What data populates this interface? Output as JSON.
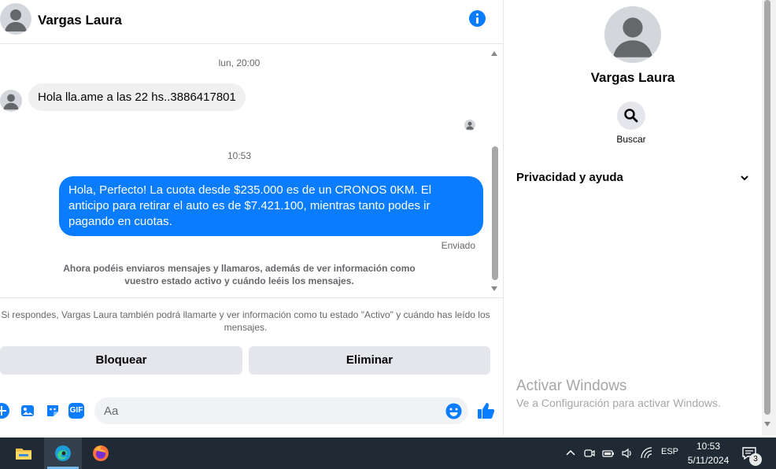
{
  "header": {
    "contact_name": "Vargas Laura"
  },
  "messages": {
    "timestamp_1": "lun, 20:00",
    "incoming_text": "Hola lla.ame a las 22 hs..3886417801",
    "timestamp_2": "10:53",
    "outgoing_text": "Hola, Perfecto! La cuota desde $235.000 es de un CRONOS 0KM. El anticipo para retirar el auto es de $7.421.100, mientras tanto podes ir pagando en cuotas.",
    "status": "Enviado",
    "notice": "Ahora podéis enviaros mensajes y llamaros, además de ver información como vuestro estado activo y cuándo leéis los mensajes."
  },
  "request": {
    "privacy_text": "Si respondes, Vargas Laura también podrá llamarte y ver información como tu estado \"Activo\" y cuándo has leído los mensajes.",
    "block_label": "Bloquear",
    "delete_label": "Eliminar"
  },
  "composer": {
    "placeholder": "Aa",
    "gif_label": "GIF",
    "icons": [
      "plus-icon",
      "photo-icon",
      "sticker-icon",
      "gif-icon",
      "emoji-icon",
      "like-icon"
    ]
  },
  "panel": {
    "contact_name": "Vargas Laura",
    "search_label": "Buscar",
    "privacy_section": "Privacidad y ayuda"
  },
  "watermark": {
    "title": "Activar Windows",
    "subtitle": "Ve a Configuración para activar Windows."
  },
  "taskbar": {
    "apps": [
      "file-explorer-icon",
      "edge-icon",
      "firefox-icon"
    ],
    "language": "ESP",
    "time": "10:53",
    "date": "5/11/2024",
    "notification_count": "3"
  },
  "colors": {
    "accent": "#0a7cff",
    "bubble_in": "#f0f0f0",
    "button_gray": "#e4e6eb",
    "taskbar": "#1f2a34"
  }
}
